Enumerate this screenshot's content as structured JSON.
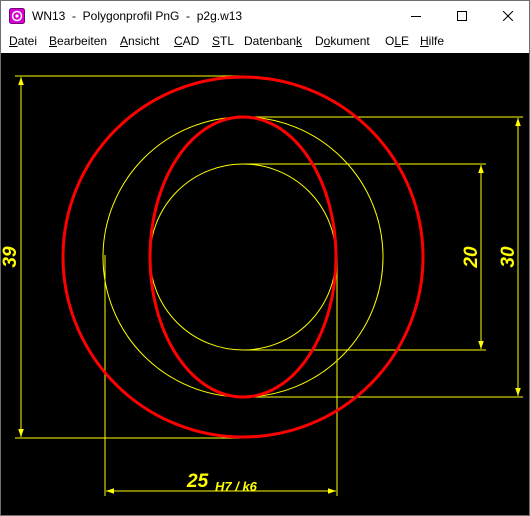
{
  "window": {
    "title": "WN13  -  Polygonprofil PnG  -  p2g.w13",
    "app_icon": "wn13-app-icon",
    "controls": [
      "minimize-icon",
      "maximize-icon",
      "close-icon"
    ]
  },
  "menu": {
    "items": [
      {
        "label": "Datei",
        "accel": "D"
      },
      {
        "label": "Bearbeiten",
        "accel": "B"
      },
      {
        "label": "Ansicht",
        "accel": "A"
      },
      {
        "label": "CAD",
        "accel": "C"
      },
      {
        "label": "STL",
        "accel": "S"
      },
      {
        "label": "Datenbank",
        "accel": "k"
      },
      {
        "label": "Dokument",
        "accel": "o"
      },
      {
        "label": "OLE",
        "accel": "L"
      },
      {
        "label": "Hilfe",
        "accel": "H"
      }
    ]
  },
  "drawing": {
    "background": "#000000",
    "profile_color": "#ff0000",
    "construction_color": "#ffff00",
    "dimensions": {
      "d39": "39",
      "d30": "30",
      "d20": "20",
      "d25": "25",
      "d25_tolerance": "H7 / k6"
    }
  }
}
